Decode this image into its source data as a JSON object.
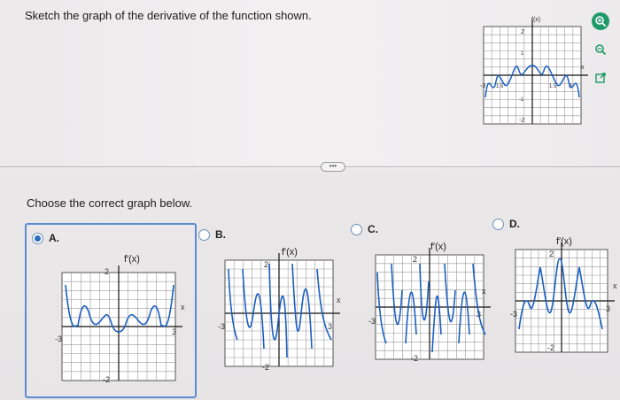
{
  "question": "Sketch the graph of the derivative of the function shown.",
  "prompt": "Choose the correct graph below.",
  "more_button": "•••",
  "source_graph": {
    "ylabel": "f(x)",
    "ticks": {
      "y_top": "2",
      "y_bottom": "-2",
      "y_one": "1",
      "y_neg_one": "-1",
      "x_left": "-3",
      "x_neg": "-1.5",
      "x_pos": "1.5",
      "x_right": "3"
    },
    "xlabel": "x"
  },
  "options": [
    {
      "letter": "A.",
      "selected": true,
      "ylabel": "f′(x)",
      "xlabel": "x",
      "y_top": "2",
      "y_bottom": "-2",
      "x_left": "-3",
      "x_right": "3"
    },
    {
      "letter": "B.",
      "selected": false,
      "ylabel": "f′(x)",
      "xlabel": "x",
      "y_top": "2",
      "y_bottom": "-2",
      "x_left": "-3",
      "x_right": "3"
    },
    {
      "letter": "C.",
      "selected": false,
      "ylabel": "f′(x)",
      "xlabel": "x",
      "y_top": "2",
      "y_bottom": "-2",
      "x_left": "-3",
      "x_right": "3"
    },
    {
      "letter": "D.",
      "selected": false,
      "ylabel": "f′(x)",
      "xlabel": "x",
      "y_top": "2",
      "y_bottom": "-2",
      "x_left": "-3",
      "x_right": "3"
    }
  ],
  "tools": [
    "zoom-in-icon",
    "zoom-out-icon",
    "external-link-icon"
  ],
  "colors": {
    "accent": "#2e6cc4",
    "selection_border": "#5d8ad0",
    "tool_green": "#1f9a6a"
  }
}
